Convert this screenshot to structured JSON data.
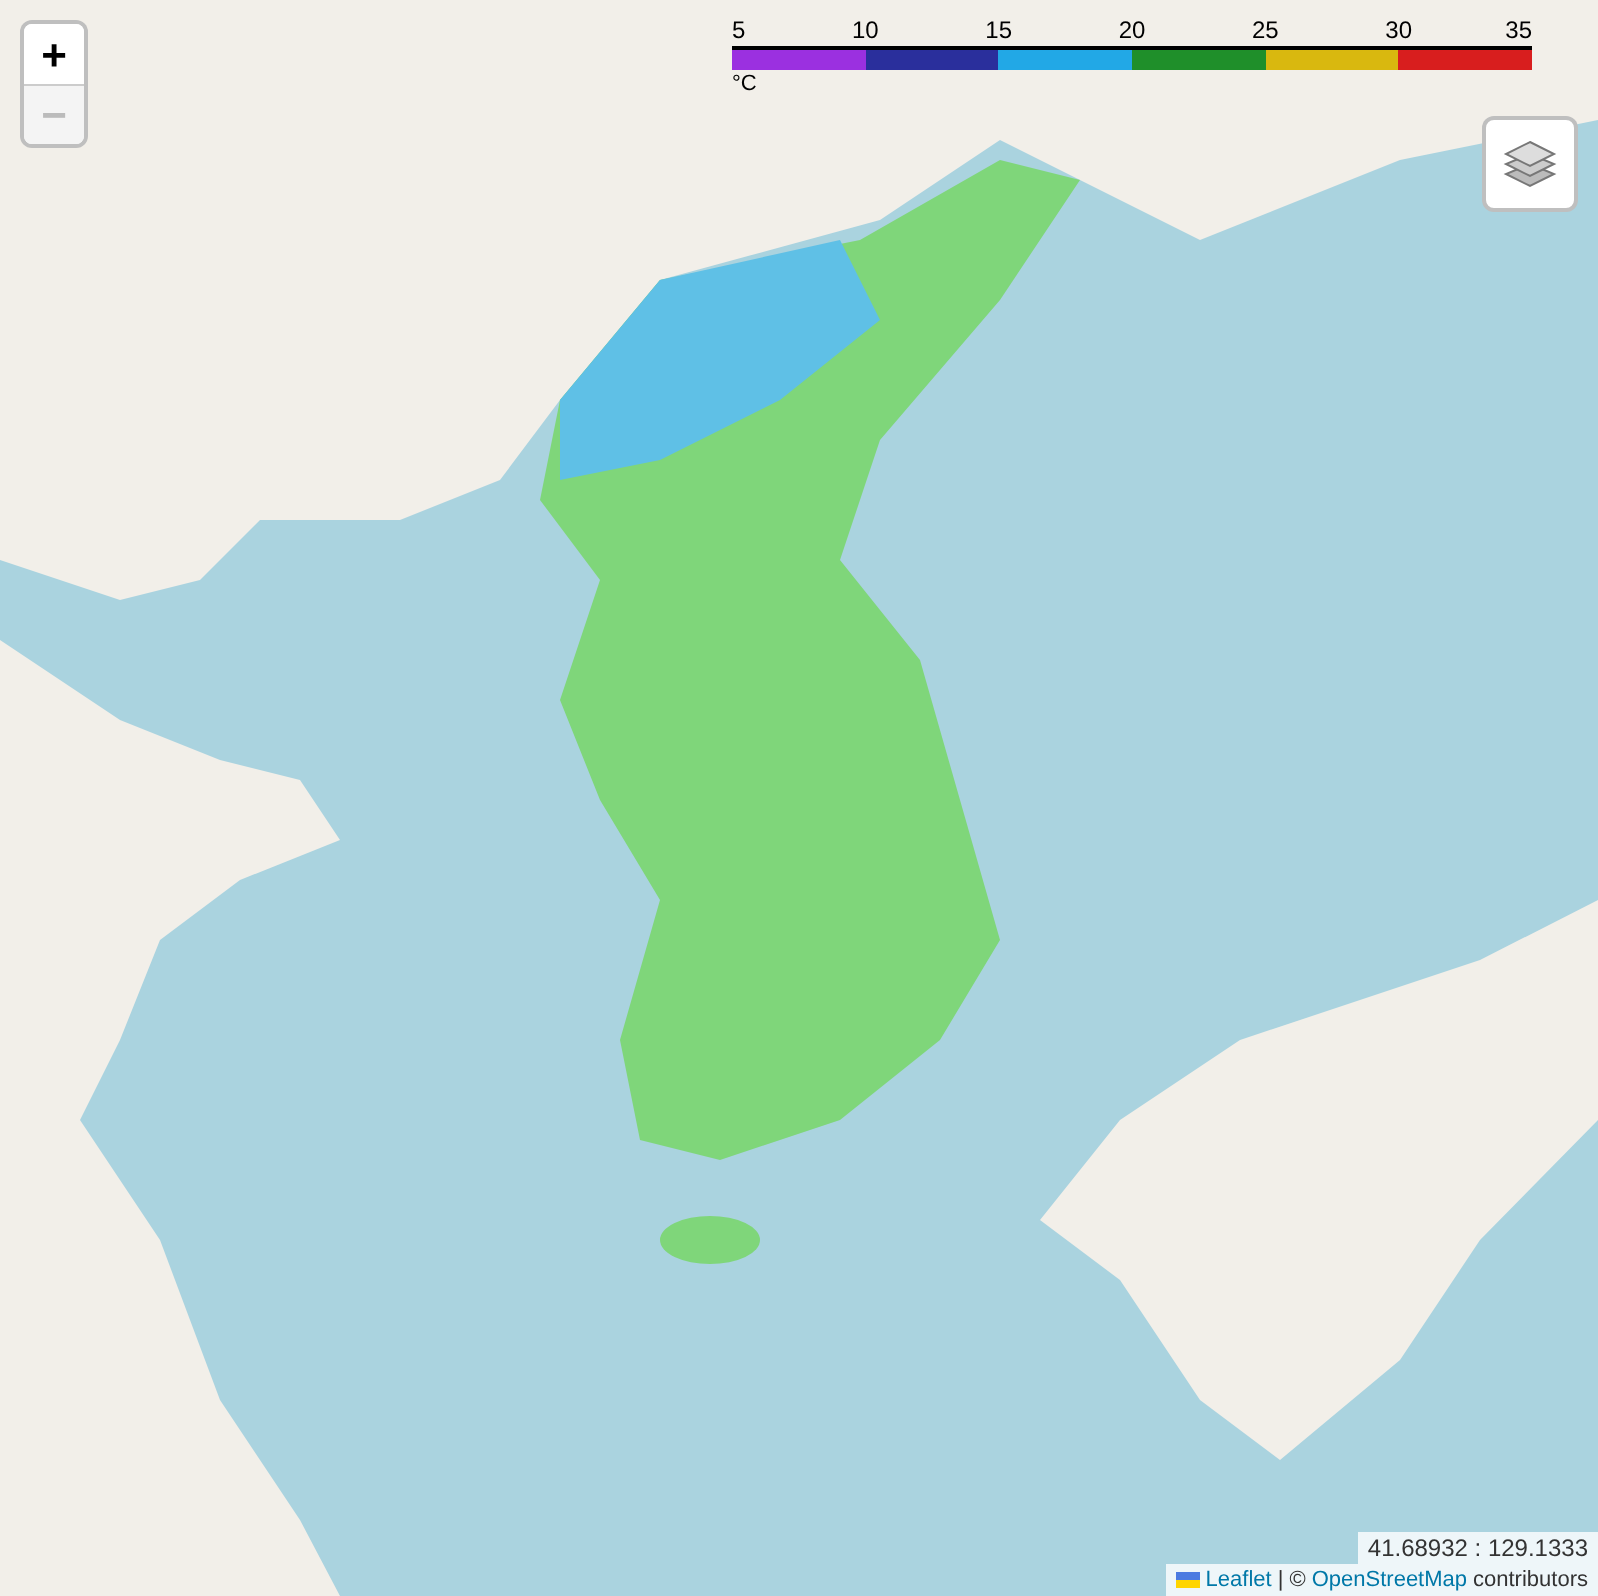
{
  "zoom_controls": [
    {
      "label": "+",
      "disabled": false
    },
    {
      "label": "−",
      "disabled": true
    }
  ],
  "legend": {
    "ticks": [
      "5",
      "10",
      "15",
      "20",
      "25",
      "30",
      "35"
    ],
    "unit": "°C",
    "segments": [
      {
        "color": "#9b30e0"
      },
      {
        "color": "#2a2f9c"
      },
      {
        "color": "#22a8e6"
      },
      {
        "color": "#1f8f2a"
      },
      {
        "color": "#d9b80f"
      },
      {
        "color": "#d81e1e"
      }
    ]
  },
  "coordinates": "41.68932 : 129.1333",
  "attribution": {
    "library": "Leaflet",
    "separator": "| ©",
    "link": "OpenStreetMap",
    "suffix": "contributors"
  }
}
